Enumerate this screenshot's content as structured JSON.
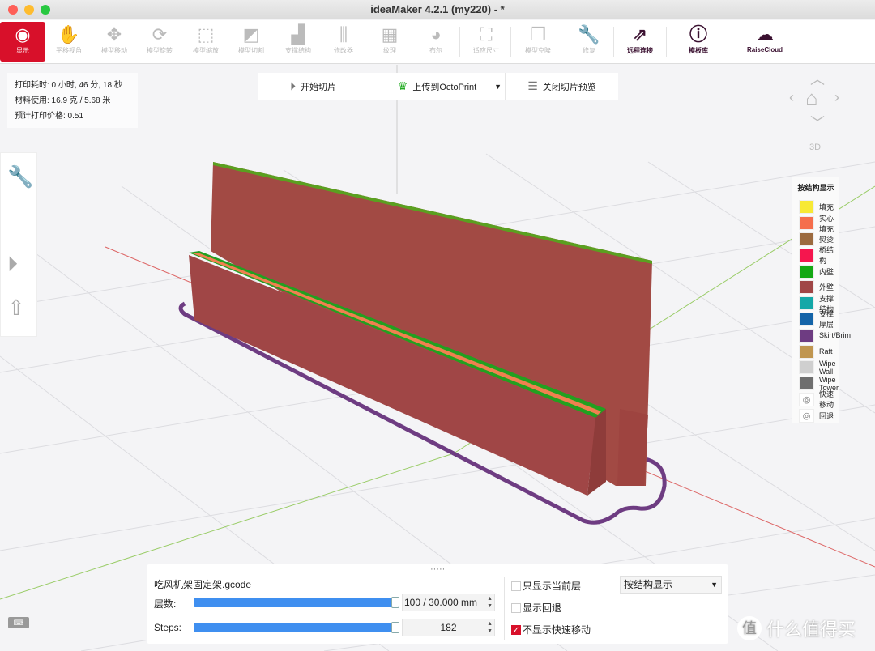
{
  "window": {
    "title": "ideaMaker 4.2.1 (my220) - *"
  },
  "toolbar": [
    {
      "label": "显示",
      "icon": "eye-icon",
      "glyph": "◉"
    },
    {
      "label": "平移视角",
      "icon": "hand-icon",
      "glyph": "✋"
    },
    {
      "label": "模型移动",
      "icon": "move-icon",
      "glyph": "✥"
    },
    {
      "label": "模型旋转",
      "icon": "rotate-icon",
      "glyph": "⟳"
    },
    {
      "label": "模型缩放",
      "icon": "scale-icon",
      "glyph": "⬚"
    },
    {
      "label": "模型切割",
      "icon": "cut-icon",
      "glyph": "◩"
    },
    {
      "label": "支撑结构",
      "icon": "support-icon",
      "glyph": "▟"
    },
    {
      "label": "修改器",
      "icon": "modifier-icon",
      "glyph": "⫼"
    },
    {
      "label": "纹理",
      "icon": "texture-icon",
      "glyph": "▦"
    },
    {
      "label": "布尔",
      "icon": "boolean-icon",
      "glyph": "◕"
    },
    {
      "label": "适应尺寸",
      "icon": "fit-size-icon",
      "glyph": "⛶"
    },
    {
      "label": "模型克隆",
      "icon": "clone-icon",
      "glyph": "❐"
    },
    {
      "label": "修复",
      "icon": "repair-icon",
      "glyph": "🔧"
    },
    {
      "label": "远程连接",
      "icon": "remote-icon",
      "glyph": "⇗"
    },
    {
      "label": "模板库",
      "icon": "info-hex-icon",
      "glyph": "ⓘ"
    },
    {
      "label": "RaiseCloud",
      "icon": "cloud-icon",
      "glyph": "☁"
    }
  ],
  "info": {
    "time": "打印耗时: 0 小时, 46 分, 18 秒",
    "material": "材料使用: 16.9 克 / 5.68 米",
    "price": "预计打印价格: 0.51"
  },
  "slicebar": {
    "start": "开始切片",
    "upload": "上传到OctoPrint",
    "close_preview": "关闭切片预览"
  },
  "legend": {
    "title": "按结构显示",
    "items": [
      {
        "label": "填充",
        "color": "#f7e935"
      },
      {
        "label": "实心填充",
        "color": "#f56e4c"
      },
      {
        "label": "熨烫",
        "color": "#9c6a3e"
      },
      {
        "label": "桥结构",
        "color": "#f5164e"
      },
      {
        "label": "内壁",
        "color": "#14a814"
      },
      {
        "label": "外壁",
        "color": "#a04646"
      },
      {
        "label": "支撑结构",
        "color": "#14a8a8"
      },
      {
        "label": "支撑厚层",
        "color": "#1464a8"
      },
      {
        "label": "Skirt/Brim",
        "color": "#6e3c82"
      },
      {
        "label": "Raft",
        "color": "#c09650"
      },
      {
        "label": "Wipe Wall",
        "color": "#cfcfcf"
      },
      {
        "label": "Wipe Tower",
        "color": "#6e6e6e"
      },
      {
        "label": "快速移动",
        "color": "hidden"
      },
      {
        "label": "回退",
        "color": "hidden"
      }
    ]
  },
  "nav": {
    "view3d": "3D"
  },
  "bottom": {
    "filename": "吃风机架固定架.gcode",
    "layers_label": "层数:",
    "layers_value": "100 / 30.000 mm",
    "layers_fraction": 1.0,
    "steps_label": "Steps:",
    "steps_value": "182",
    "steps_fraction": 1.0,
    "only_current": "只显示当前层",
    "only_current_checked": false,
    "show_retract": "显示回退",
    "show_retract_checked": false,
    "hide_travel": "不显示快速移动",
    "hide_travel_checked": true,
    "mode": "按结构显示"
  },
  "watermark": {
    "text": "什么值得买",
    "badge": "值"
  }
}
